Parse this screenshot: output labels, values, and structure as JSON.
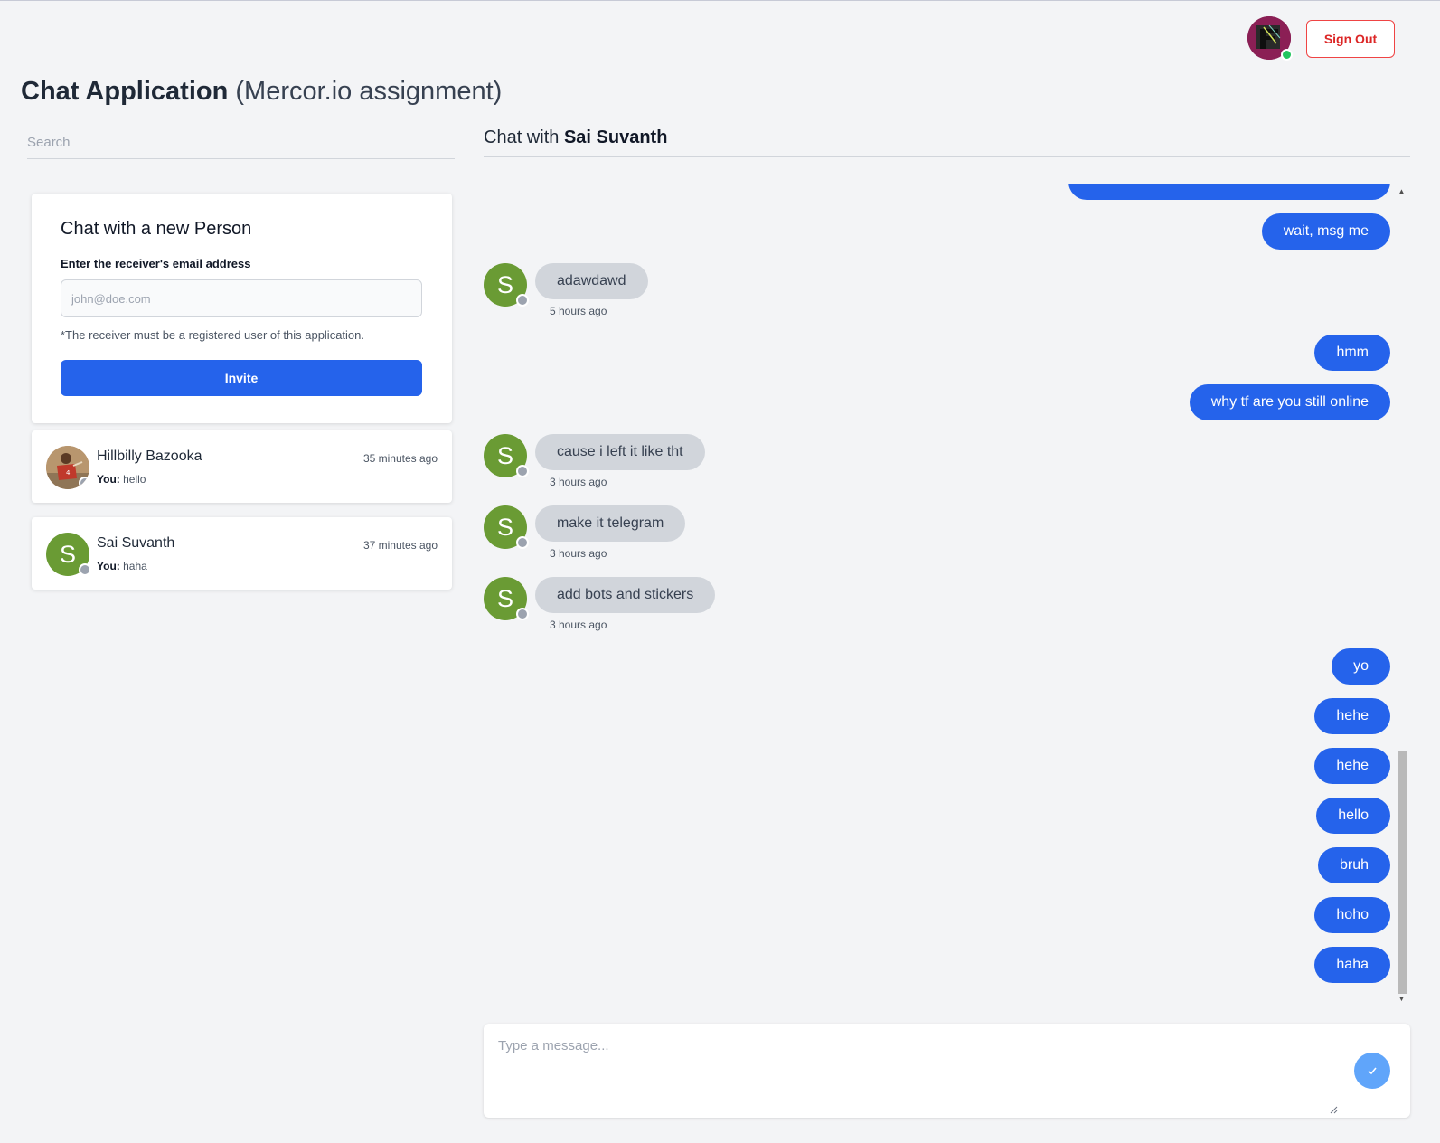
{
  "header": {
    "title_strong": "Chat Application",
    "title_light": "(Mercor.io assignment)",
    "signout_label": "Sign Out"
  },
  "sidebar": {
    "search_placeholder": "Search",
    "new_chat": {
      "heading": "Chat with a new Person",
      "email_label": "Enter the receiver's email address",
      "email_placeholder": "john@doe.com",
      "hint": "*The receiver must be a registered user of this application.",
      "invite_label": "Invite"
    },
    "conversations": [
      {
        "name": "Hillbilly Bazooka",
        "time": "35 minutes ago",
        "prefix": "You:",
        "preview": "hello",
        "status": "offline"
      },
      {
        "name": "Sai Suvanth",
        "initial": "S",
        "time": "37 minutes ago",
        "prefix": "You:",
        "preview": "haha",
        "status": "offline"
      }
    ]
  },
  "chat": {
    "title_prefix": "Chat with",
    "partner_name": "Sai Suvanth",
    "messages": [
      {
        "dir": "out",
        "text": "wait, msg me"
      },
      {
        "dir": "in",
        "text": "adawdawd",
        "time": "5 hours ago",
        "initial": "S"
      },
      {
        "dir": "out",
        "text": "hmm"
      },
      {
        "dir": "out",
        "text": "why tf are you still online"
      },
      {
        "dir": "in",
        "text": "cause i left it like tht",
        "time": "3 hours ago",
        "initial": "S"
      },
      {
        "dir": "in",
        "text": "make it telegram",
        "time": "3 hours ago",
        "initial": "S"
      },
      {
        "dir": "in",
        "text": "add bots and stickers",
        "time": "3 hours ago",
        "initial": "S"
      },
      {
        "dir": "out",
        "text": "yo"
      },
      {
        "dir": "out",
        "text": "hehe"
      },
      {
        "dir": "out",
        "text": "hehe"
      },
      {
        "dir": "out",
        "text": "hello"
      },
      {
        "dir": "out",
        "text": "bruh"
      },
      {
        "dir": "out",
        "text": "hoho"
      },
      {
        "dir": "out",
        "text": "haha"
      }
    ],
    "composer_placeholder": "Type a message..."
  },
  "colors": {
    "primary": "#2563eb",
    "danger": "#dc2626",
    "online": "#22c55e",
    "offline": "#9ca3af",
    "avatar_green": "#6a9b34",
    "incoming_bubble": "#d1d5db"
  },
  "icons": {
    "send": "check-icon",
    "scroll_up": "triangle-up-icon",
    "scroll_down": "triangle-down-icon"
  }
}
